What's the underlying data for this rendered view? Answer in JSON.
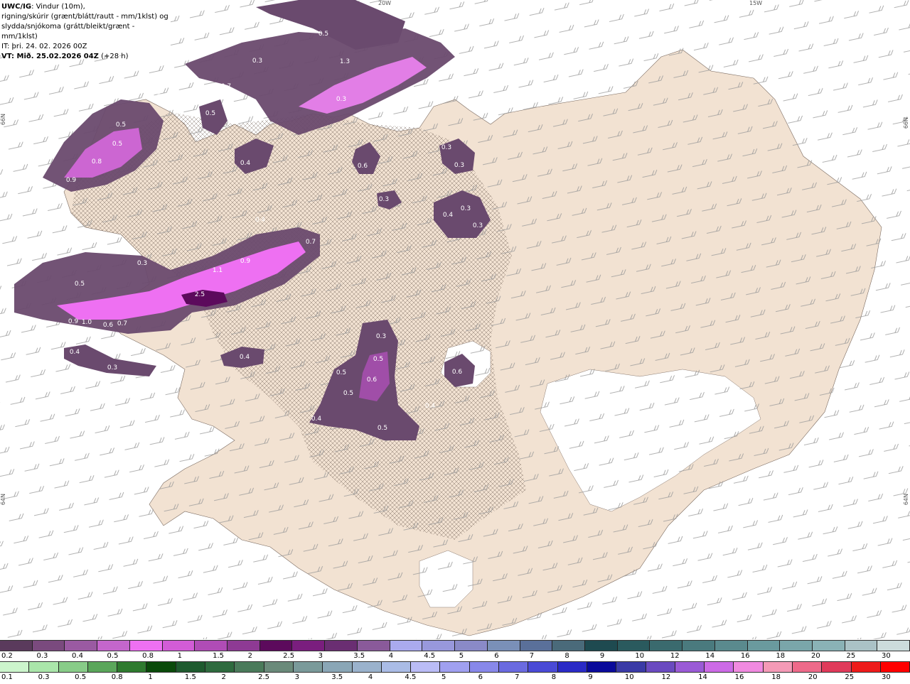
{
  "header": {
    "line1_bold": "UWC/IG",
    "line1_rest": ": Vindur (10m),",
    "line2": "rigning/skúrir (grænt/blátt/rautt - mm/1klst) og",
    "line3": "slydda/snjókoma (grátt/bleikt/grænt - mm/1klst)",
    "line4": "IT: þri. 24. 02. 2026 00Z",
    "line5_bold": "VT: Mið. 25.02.2026 04Z",
    "line5_rest": " (+28 h)"
  },
  "grid_labels": {
    "top_20w": "20W",
    "top_15w": "15W",
    "left_66n": "66N",
    "left_64n": "64N",
    "right_66n": "66N",
    "right_64n": "64N"
  },
  "map_values": [
    "0.5",
    "0.3",
    "1.3",
    "0.3",
    "0.7",
    "0.3",
    "0.7",
    "0.5",
    "0.5",
    "0.5",
    "0.8",
    "0.9",
    "0.4",
    "0.6",
    "0.3",
    "0.3",
    "0.3",
    "0.4",
    "0.4",
    "0.3",
    "0.3",
    "0.7",
    "1.1",
    "0.9",
    "0.3",
    "0.5",
    "2.5",
    "0.9",
    "1.0",
    "0.7",
    "0.4",
    "0.3",
    "0.4",
    "0.3",
    "0.5",
    "0.6",
    "0.6",
    "0.5",
    "0.5",
    "0.4",
    "0.5",
    "0.4",
    "0.6"
  ],
  "legend_top": {
    "colors": [
      "#5a3a5c",
      "#7a4a7e",
      "#9a5aa2",
      "#c466cc",
      "#ee70f2",
      "#d25cd6",
      "#b04cb6",
      "#8e3a94",
      "#5c0a5c",
      "#7a1e7e",
      "#6a2e72",
      "#8a5a9a",
      "#aaaaee",
      "#9898dc",
      "#8a8ac8",
      "#7a90b8",
      "#5a709a",
      "#4a6a7a",
      "#1e4a50",
      "#2a5a5e",
      "#3a6a6e",
      "#4a7a7e",
      "#5a8a8e",
      "#6a9a9e",
      "#7aa6aa",
      "#8ab2b6",
      "#aac2c6",
      "#ccdcdc"
    ],
    "labels": [
      "0.2",
      "0.3",
      "0.4",
      "0.5",
      "0.8",
      "1",
      "1.5",
      "2",
      "2.5",
      "3",
      "3.5",
      "4",
      "4.5",
      "5",
      "6",
      "7",
      "8",
      "9",
      "10",
      "12",
      "14",
      "16",
      "18",
      "20",
      "25",
      "30"
    ]
  },
  "legend_bottom": {
    "colors": [
      "#ccf5cc",
      "#aae6aa",
      "#88cc88",
      "#5aa65a",
      "#2e7a2e",
      "#0a4a0a",
      "#1e5a2e",
      "#2e6a3e",
      "#4a7a5a",
      "#6a8a7a",
      "#7a9a9a",
      "#8aa6b6",
      "#9ab2cc",
      "#aabce6",
      "#babcf6",
      "#a0a0f0",
      "#8888ea",
      "#6a6ae0",
      "#4a4ad6",
      "#2a2ac6",
      "#0a0a9a",
      "#3a3aa6",
      "#6a4ac0",
      "#9a5ad6",
      "#cc6ae6",
      "#f08ae0",
      "#f49ab6",
      "#ee6a8a",
      "#e03a5a",
      "#ee1a1a",
      "#ff0000"
    ],
    "labels": [
      "0.1",
      "0.3",
      "0.5",
      "0.8",
      "1",
      "1.5",
      "2",
      "2.5",
      "3",
      "3.5",
      "4",
      "4.5",
      "5",
      "6",
      "7",
      "8",
      "9",
      "10",
      "12",
      "14",
      "16",
      "18",
      "20",
      "25",
      "30"
    ]
  }
}
